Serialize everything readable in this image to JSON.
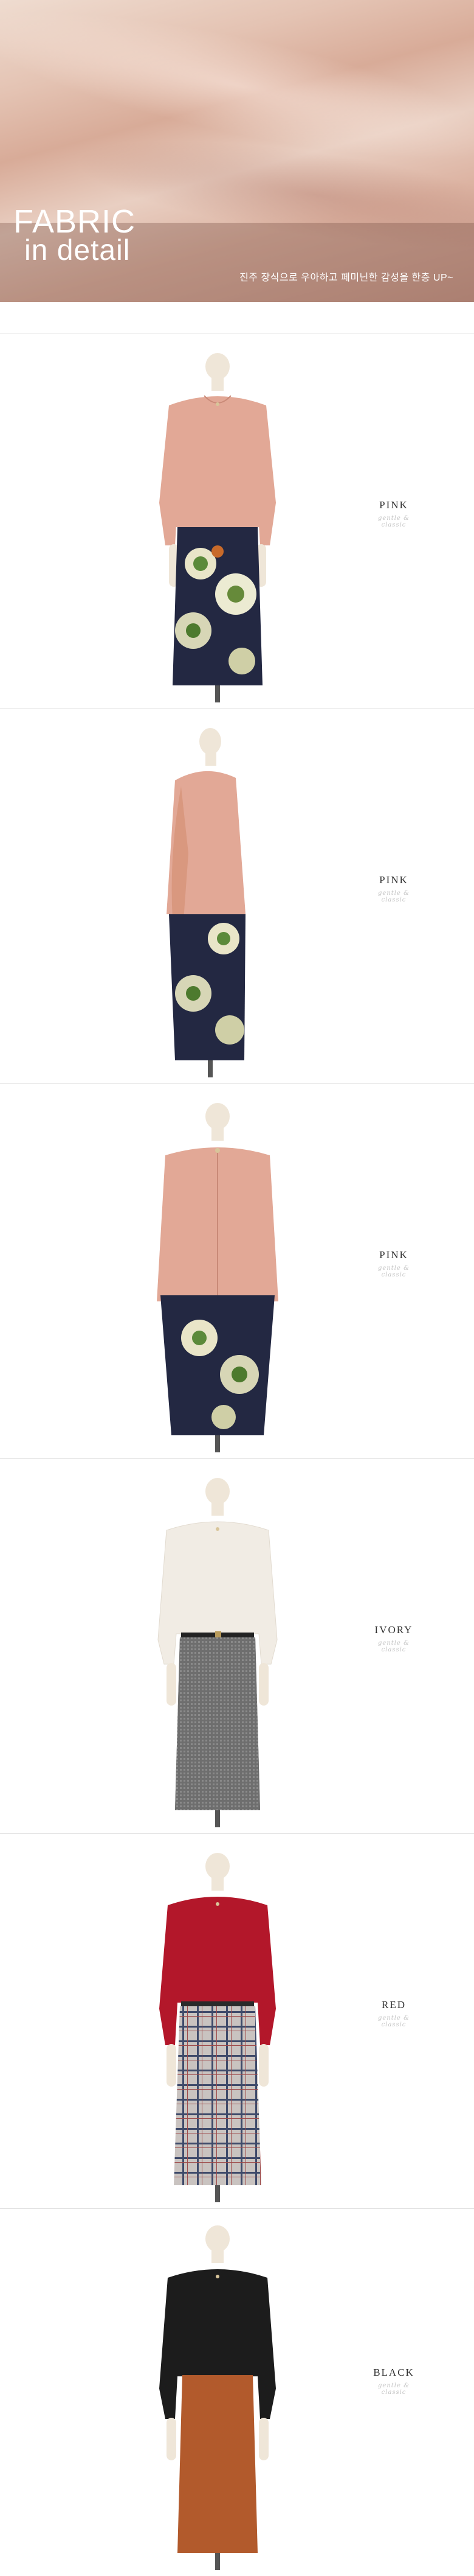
{
  "hero": {
    "title_line1": "FABRIC",
    "title_line2": "in detail",
    "caption": "진주 장식으로 우아하고 페미닌한 감성을 한층 UP~"
  },
  "products": [
    {
      "color_label": "PINK",
      "signature": "gentle & classic",
      "view": "front",
      "top_color": "#e2a896",
      "skirt": "floral-navy"
    },
    {
      "color_label": "PINK",
      "signature": "gentle & classic",
      "view": "side",
      "top_color": "#e2a896",
      "skirt": "floral-navy"
    },
    {
      "color_label": "PINK",
      "signature": "gentle & classic",
      "view": "back",
      "top_color": "#e2a896",
      "skirt": "floral-navy"
    },
    {
      "color_label": "IVORY",
      "signature": "gentle & classic",
      "view": "front",
      "top_color": "#f1ece4",
      "skirt": "grey-tweed"
    },
    {
      "color_label": "RED",
      "signature": "gentle & classic",
      "view": "front",
      "top_color": "#b3172a",
      "skirt": "plaid"
    },
    {
      "color_label": "BLACK",
      "signature": "gentle & classic",
      "view": "front",
      "top_color": "#1c1c1c",
      "skirt": "rust"
    }
  ]
}
